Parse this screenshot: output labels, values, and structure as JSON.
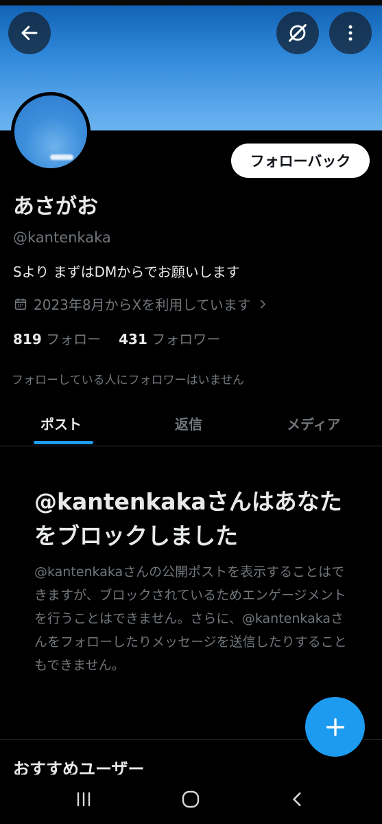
{
  "header": {
    "back_icon": "arrow-left-icon",
    "grok_icon": "grok-slash-circle-icon",
    "more_icon": "more-vertical-icon"
  },
  "profile": {
    "follow_back_label": "フォローバック",
    "name": "あさがお",
    "handle": "@kantenkaka",
    "bio": "Sより まずはDMからでお願いします",
    "joined": "2023年8月からXを利用しています",
    "following_count": "819",
    "following_label": "フォロー",
    "followers_count": "431",
    "followers_label": "フォロワー",
    "mutual_text": "フォローしている人にフォロワーはいません"
  },
  "tabs": [
    {
      "label": "ポスト",
      "active": true
    },
    {
      "label": "返信",
      "active": false
    },
    {
      "label": "メディア",
      "active": false
    }
  ],
  "block_notice": {
    "title": "@kantenkakaさんはあなたをブロックしました",
    "body": "@kantenkakaさんの公開ポストを表示することはできますが、ブロックされているためエンゲージメントを行うことはできません。さらに、@kantenkakaさんをフォローしたりメッセージを送信したりすることもできません。"
  },
  "recommended": {
    "title": "おすすめユーザー"
  },
  "colors": {
    "accent": "#1d9bf0",
    "background": "#000000",
    "muted_text": "#71767b"
  }
}
